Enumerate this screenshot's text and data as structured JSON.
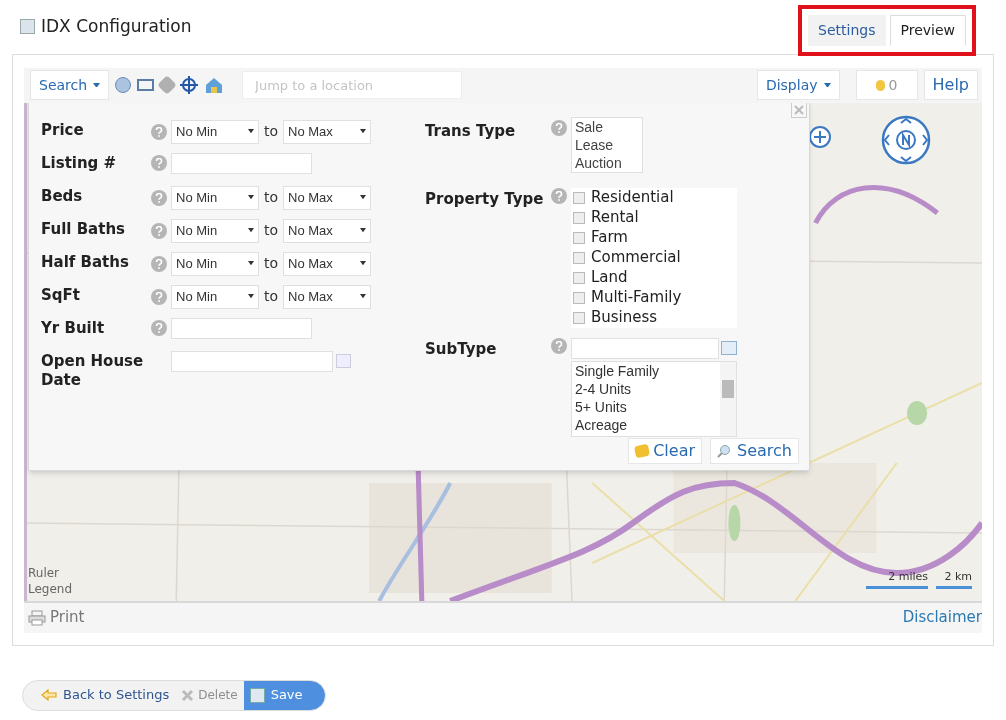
{
  "header": {
    "title": "IDX Configuration",
    "tabs": [
      {
        "label": "Settings",
        "selected": false
      },
      {
        "label": "Preview",
        "selected": true
      }
    ],
    "highlight": true
  },
  "toolbar": {
    "search_menu": "Search",
    "location": {
      "placeholder": "Jump to a location"
    },
    "display_menu": "Display",
    "count": "0",
    "help": "Help"
  },
  "search_form": {
    "fields": [
      {
        "kind": "range",
        "label": "Price",
        "min": "No Min",
        "joiner": "to",
        "max": "No Max"
      },
      {
        "kind": "text",
        "label": "Listing #"
      },
      {
        "kind": "range",
        "label": "Beds",
        "min": "No Min",
        "joiner": "to",
        "max": "No Max"
      },
      {
        "kind": "range",
        "label": "Full Baths",
        "min": "No Min",
        "joiner": "to",
        "max": "No Max"
      },
      {
        "kind": "range",
        "label": "Half Baths",
        "min": "No Min",
        "joiner": "to",
        "max": "No Max"
      },
      {
        "kind": "range",
        "label": "SqFt",
        "min": "No Min",
        "joiner": "to",
        "max": "No Max"
      },
      {
        "kind": "text",
        "label": "Yr Built"
      },
      {
        "kind": "date",
        "label": "Open House Date"
      }
    ],
    "trans_type": {
      "label": "Trans Type",
      "options": [
        "Sale",
        "Lease",
        "Auction"
      ]
    },
    "property_type": {
      "label": "Property Type",
      "options": [
        {
          "label": "Residential",
          "checked": false
        },
        {
          "label": "Rental",
          "checked": false
        },
        {
          "label": "Farm",
          "checked": false
        },
        {
          "label": "Commercial",
          "checked": false
        },
        {
          "label": "Land",
          "checked": false
        },
        {
          "label": "Multi-Family",
          "checked": false
        },
        {
          "label": "Business",
          "checked": false
        }
      ]
    },
    "subtype": {
      "label": "SubType",
      "options": [
        "Single Family",
        "2-4 Units",
        "5+ Units",
        "Acreage"
      ]
    },
    "buttons": {
      "clear": "Clear",
      "search": "Search"
    }
  },
  "map": {
    "ruler": "Ruler",
    "legend": "Legend",
    "scale": [
      "2 miles",
      "2 km"
    ]
  },
  "footer": {
    "print": "Print",
    "disclaimer": "Disclaimer"
  },
  "actions": {
    "back": "Back to Settings",
    "delete": {
      "label": "Delete",
      "disabled": true
    },
    "save": "Save"
  }
}
